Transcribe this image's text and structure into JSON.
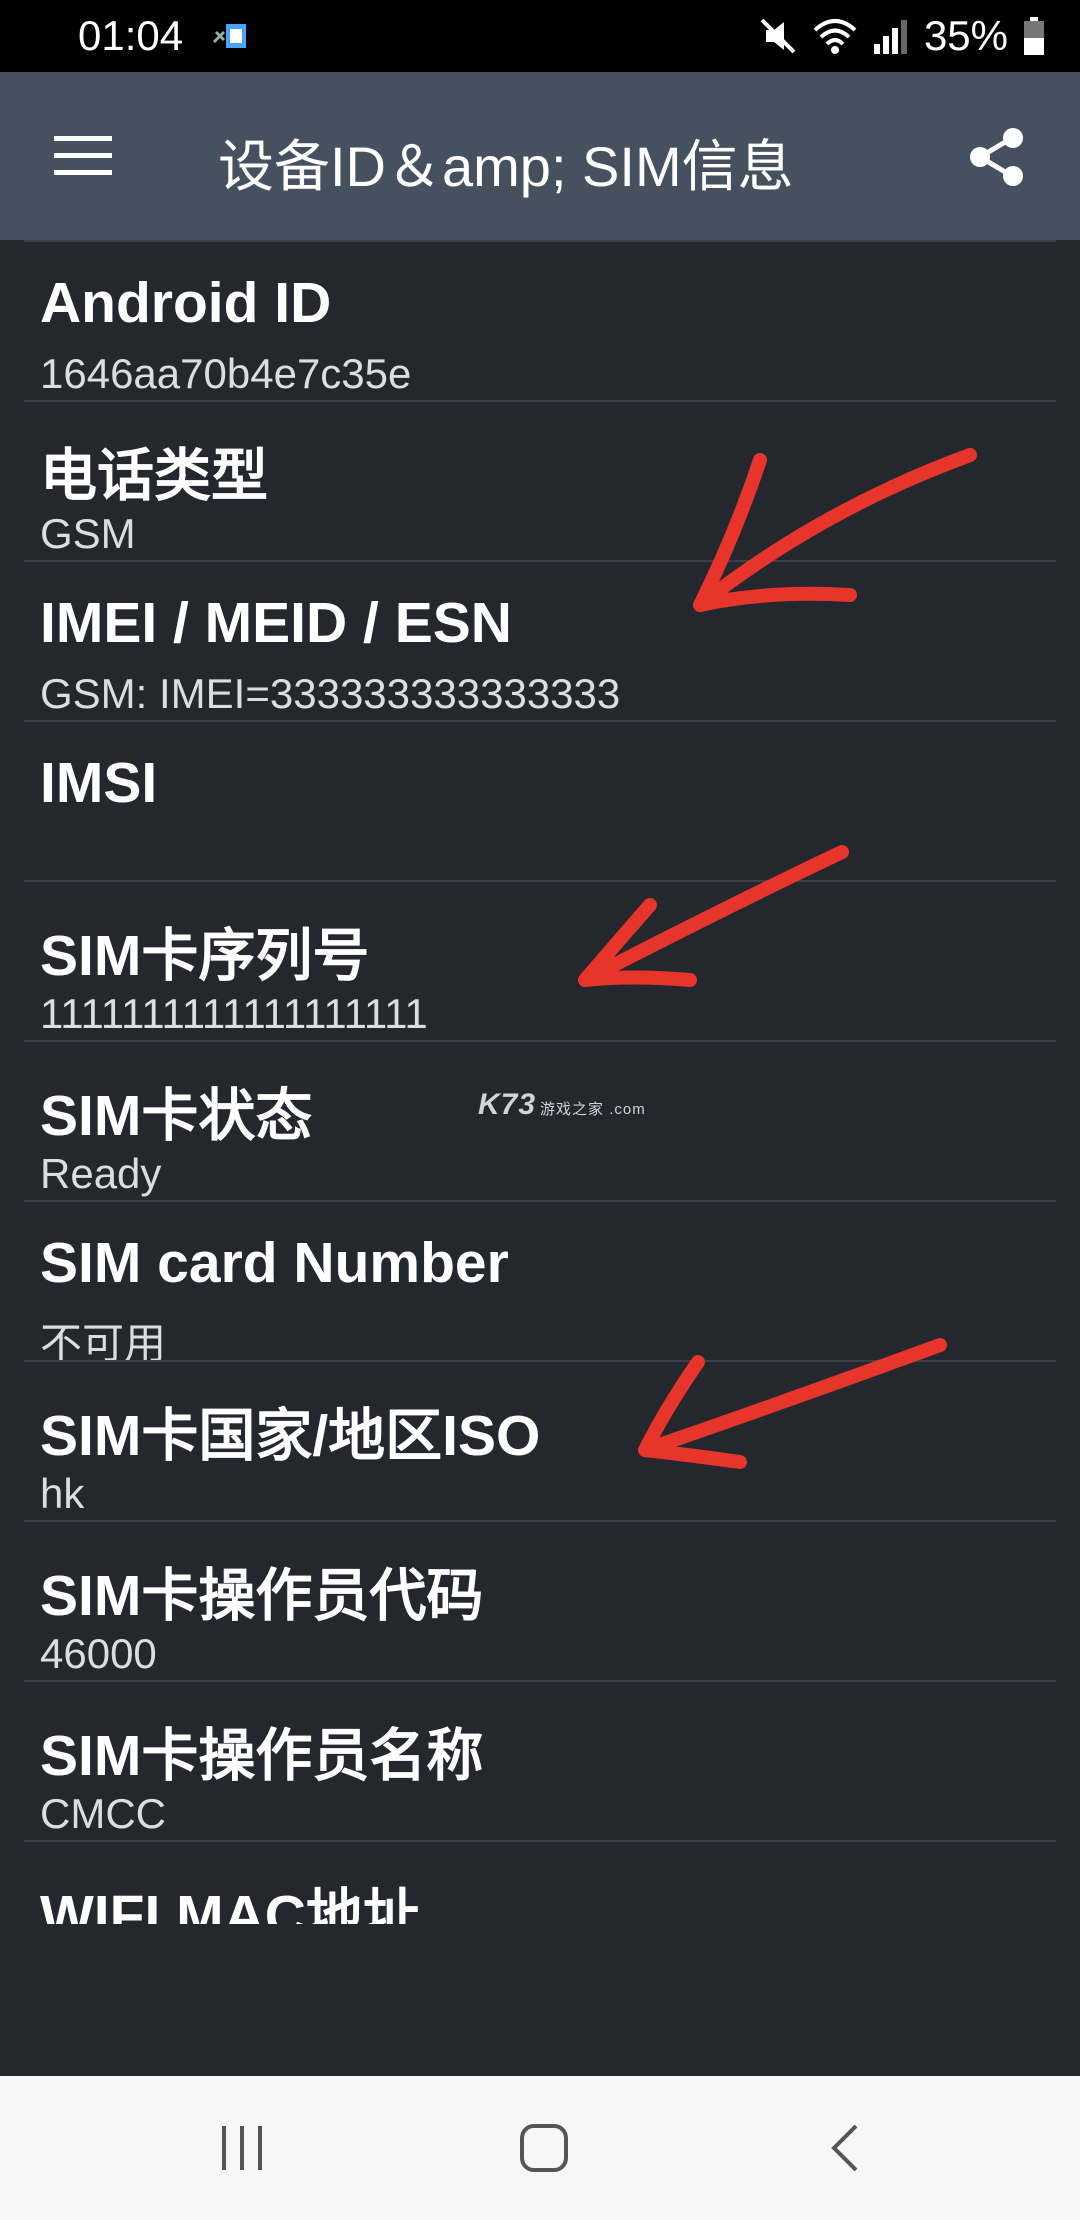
{
  "status_bar": {
    "time": "01:04",
    "battery_percent": "35%",
    "icons": [
      "notification-icon",
      "mute-icon",
      "wifi-icon",
      "signal-icon",
      "battery-icon"
    ]
  },
  "app_bar": {
    "title": "设备ID＆amp; SIM信息",
    "menu_icon": "hamburger-menu-icon",
    "share_icon": "share-icon"
  },
  "list": {
    "items": [
      {
        "label": "Android ID",
        "value": "1646aa70b4e7c35e"
      },
      {
        "label": "电话类型",
        "value": "GSM"
      },
      {
        "label": "IMEI / MEID / ESN",
        "value": "GSM: IMEI=333333333333333"
      },
      {
        "label": "IMSI",
        "value": ""
      },
      {
        "label": "SIM卡序列号",
        "value": "1111111111111111111"
      },
      {
        "label": "SIM卡状态",
        "value": "Ready"
      },
      {
        "label": "SIM card Number",
        "value": "不可用"
      },
      {
        "label": "SIM卡国家/地区ISO",
        "value": "hk"
      },
      {
        "label": "SIM卡操作员代码",
        "value": "46000"
      },
      {
        "label": "SIM卡操作员名称",
        "value": "CMCC"
      },
      {
        "label": "WIFI MAC地址",
        "value": ""
      }
    ]
  },
  "watermark": {
    "main": "K73",
    "sub": "游戏之家 .com"
  },
  "annotations": {
    "arrow_color": "#e8352b",
    "arrow_count": 3
  },
  "nav_bar": {
    "buttons": [
      "recent-apps-icon",
      "home-icon",
      "back-icon"
    ]
  },
  "colors": {
    "app_bar": "#465160",
    "background": "#24272e",
    "divider": "#3b3f47",
    "nav_bar": "#f7f7f7"
  }
}
